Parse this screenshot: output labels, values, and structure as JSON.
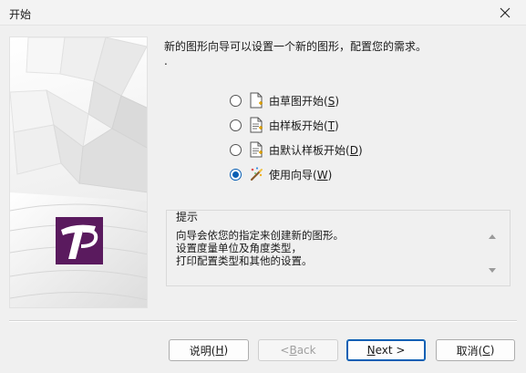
{
  "window": {
    "title": "开始"
  },
  "intro": {
    "line1": "新的图形向导可以设置一个新的图形，配置您的需求。",
    "line2": "."
  },
  "options": [
    {
      "label": "由草图开始(",
      "mnemonic": "S",
      "suffix": ")",
      "icon": "blank-document-icon",
      "checked": false
    },
    {
      "label": "由样板开始(",
      "mnemonic": "T",
      "suffix": ")",
      "icon": "template-document-icon",
      "checked": false
    },
    {
      "label": "由默认样板开始(",
      "mnemonic": "D",
      "suffix": ")",
      "icon": "default-template-document-icon",
      "checked": false
    },
    {
      "label": "使用向导(",
      "mnemonic": "W",
      "suffix": ")",
      "icon": "magic-wand-icon",
      "checked": true
    }
  ],
  "hint": {
    "title": "提示",
    "text": "向导会依您的指定来创建新的图形。\n设置度量单位及角度类型，\n打印配置类型和其他的设置。"
  },
  "buttons": {
    "help_label": "说明(",
    "help_mnemonic": "H",
    "back_label": "< ",
    "back_mnemonic": "B",
    "back_rest": "ack",
    "next_mnemonic": "N",
    "next_rest": "ext >",
    "cancel_label": "取消(",
    "cancel_mnemonic": "C"
  },
  "colors": {
    "accent": "#0a5fb4",
    "logo_bg": "#5a1a5e",
    "window_bg": "#f0f0f0"
  }
}
